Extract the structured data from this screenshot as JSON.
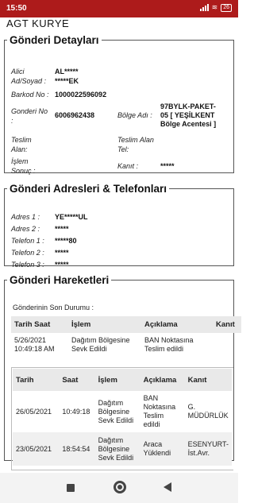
{
  "status_bar": {
    "time": "15:50",
    "battery": "26"
  },
  "app": {
    "title": "AGT KURYE"
  },
  "gonderi_detaylari": {
    "legend": "Gönderi Detayları",
    "alici_label": "Alici",
    "alici_value": "AL*****",
    "adsoyad_label": "Ad/Soyad :",
    "adsoyad_value": "*****EK",
    "barkod_label": "Barkod No :",
    "barkod_value": "1000022596092",
    "gonderi_label_1": "Gonderi No",
    "gonderi_label_2": ":",
    "gonderi_value": "6006962438",
    "bolge_label": "Bölge Adı :",
    "bolge_value_1": "97BYLK-PAKET-",
    "bolge_value_2": "05 [ YEŞİLKENT",
    "bolge_value_3": "Bölge Acentesi ]",
    "teslim_label_1": "Teslim",
    "teslim_label_2": "Alan:",
    "teslim_alan_tel_label_1": "Teslim Alan",
    "teslim_alan_tel_label_2": "Tel:",
    "islem_label_1": "İşlem",
    "islem_label_2": "Sonuç :",
    "kanit_label": "Kanıt :",
    "kanit_value": "*****"
  },
  "gonderi_adresleri": {
    "legend": "Gönderi Adresleri & Telefonları",
    "adres1_label": "Adres 1 :",
    "adres1_value": "YE*****UL",
    "adres2_label": "Adres 2 :",
    "adres2_value": "*****",
    "tel1_label": "Telefon 1 :",
    "tel1_value": "*****80",
    "tel2_label": "Telefon 2 :",
    "tel2_value": "*****",
    "tel3_label": "Telefon 3 :",
    "tel3_value": "*****"
  },
  "gonderi_hareketleri": {
    "legend": "Gönderi Hareketleri",
    "son_durum_label": "Gönderinin Son Durumu :",
    "son_durum_table": {
      "headers": [
        "Tarih Saat",
        "İşlem",
        "Açıklama",
        "Kanıt"
      ],
      "row": {
        "tarih_1": "5/26/2021",
        "tarih_2": "10:49:18 AM",
        "islem_1": "Dağıtım Bölgesine",
        "islem_2": "Sevk Edildi",
        "aciklama_1": "BAN Noktasına",
        "aciklama_2": "Teslim edildi",
        "kanit": ""
      }
    },
    "history_table": {
      "headers": [
        "Tarih",
        "Saat",
        "İşlem",
        "Açıklama",
        "Kanıt"
      ],
      "rows": [
        {
          "tarih": "26/05/2021",
          "saat": "10:49:18",
          "islem_1": "Dağıtım",
          "islem_2": "Bölgesine",
          "islem_3": "Sevk Edildi",
          "aciklama_1": "BAN",
          "aciklama_2": "Noktasına",
          "aciklama_3": "Teslim",
          "aciklama_4": "edildi",
          "kanit_1": "G.",
          "kanit_2": "MÜDÜRLÜK"
        },
        {
          "tarih": "23/05/2021",
          "saat": "18:54:54",
          "islem_1": "Dağıtım",
          "islem_2": "Bölgesine",
          "islem_3": "Sevk Edildi",
          "aciklama_1": "Araca",
          "aciklama_2": "Yüklendi",
          "kanit_1": "ESENYURT-",
          "kanit_2": "İst.Avr."
        }
      ]
    }
  },
  "colors": {
    "status_bar": "#ad1b1b",
    "header_row": "#e9e9e9"
  }
}
